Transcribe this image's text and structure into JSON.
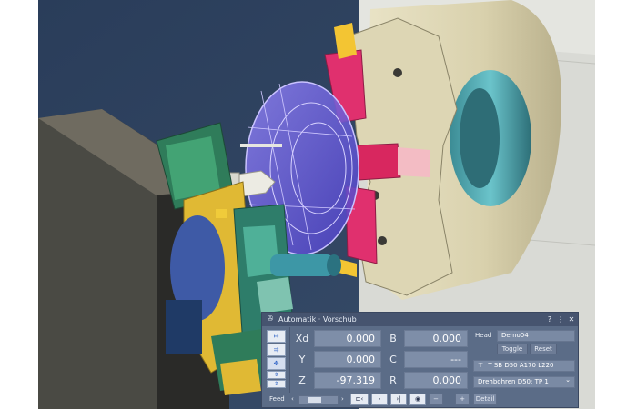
{
  "panel": {
    "title": "Automatik · Vorschub",
    "title_icon": "tool-icon",
    "title_buttons": [
      "?",
      "⋮",
      "✕"
    ],
    "mode_buttons": [
      {
        "icon": "arrow-right-icon",
        "glyph": "↦"
      },
      {
        "icon": "arrows-right-icon",
        "glyph": "⇉"
      },
      {
        "icon": "move-icon",
        "glyph": "✥"
      },
      {
        "icon": "up-down-icon",
        "glyph": "⇕"
      }
    ],
    "axes": [
      {
        "label": "Xd",
        "value": "0.000"
      },
      {
        "label": "Y",
        "value": "0.000"
      },
      {
        "label": "Z",
        "value": "-97.319"
      }
    ],
    "axes_right": [
      {
        "label": "B",
        "value": "0.000"
      },
      {
        "label": "C",
        "value": "---"
      },
      {
        "label": "R",
        "value": "0.000"
      }
    ],
    "head": {
      "label": "Head",
      "value": "Demo04"
    },
    "buttons": {
      "toggle": "Toggle",
      "reset": "Reset"
    },
    "tool": {
      "icon": "tool-holder-icon",
      "glyph": "⊤",
      "text": "T SB D50 A170 L220"
    },
    "program": {
      "text": "Drehbohren D50: TP 1",
      "arrow": "⌄"
    },
    "feed": {
      "label": "Feed",
      "left_arrow": "‹",
      "right_arrow": "›",
      "level": 0.35,
      "controls": [
        {
          "name": "step-back-button",
          "glyph": "⊏‹"
        },
        {
          "name": "play-button",
          "glyph": "›"
        },
        {
          "name": "step-forward-button",
          "glyph": "›|"
        },
        {
          "name": "record-button",
          "glyph": "◉"
        }
      ],
      "minus": "−",
      "plus": "+",
      "detail": "Detail"
    }
  },
  "colors": {
    "panel_bg": "#5b6c87",
    "titlebar_bg": "#46546f",
    "value_bg": "#7e8ea8",
    "accent_blue": "#2f63c7",
    "chuck_purple": "#6f5fe0",
    "jaw_pink": "#e0306e",
    "spindle_cream": "#e7e0c2"
  }
}
